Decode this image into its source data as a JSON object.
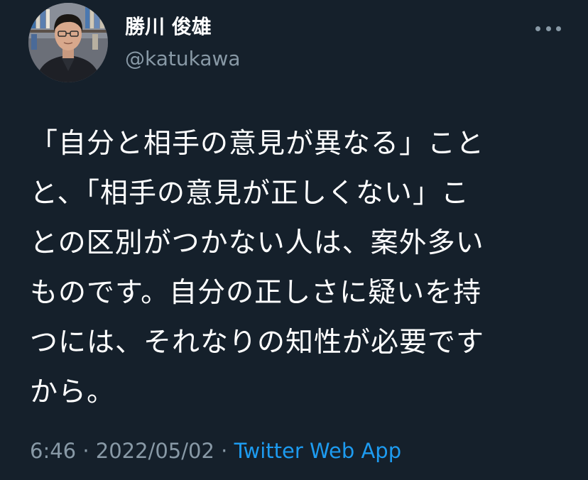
{
  "author": {
    "display_name": "勝川 俊雄",
    "handle": "@katukawa"
  },
  "more_icon": "ellipsis-icon",
  "tweet": {
    "lines": [
      "「自分と相手の意見が異なる」こと",
      "と、「相手の意見が正しくない」こ",
      "との区別がつかない人は、案外多い",
      "ものです。自分の正しさに疑いを持",
      "つには、それなりの知性が必要です",
      "から。"
    ]
  },
  "meta": {
    "time": "6:46",
    "separator": " · ",
    "date": "2022/05/02",
    "source": "Twitter Web App"
  },
  "colors": {
    "background": "#15202b",
    "text": "#ffffff",
    "secondary": "#8899a6",
    "link": "#1d9bf0"
  }
}
